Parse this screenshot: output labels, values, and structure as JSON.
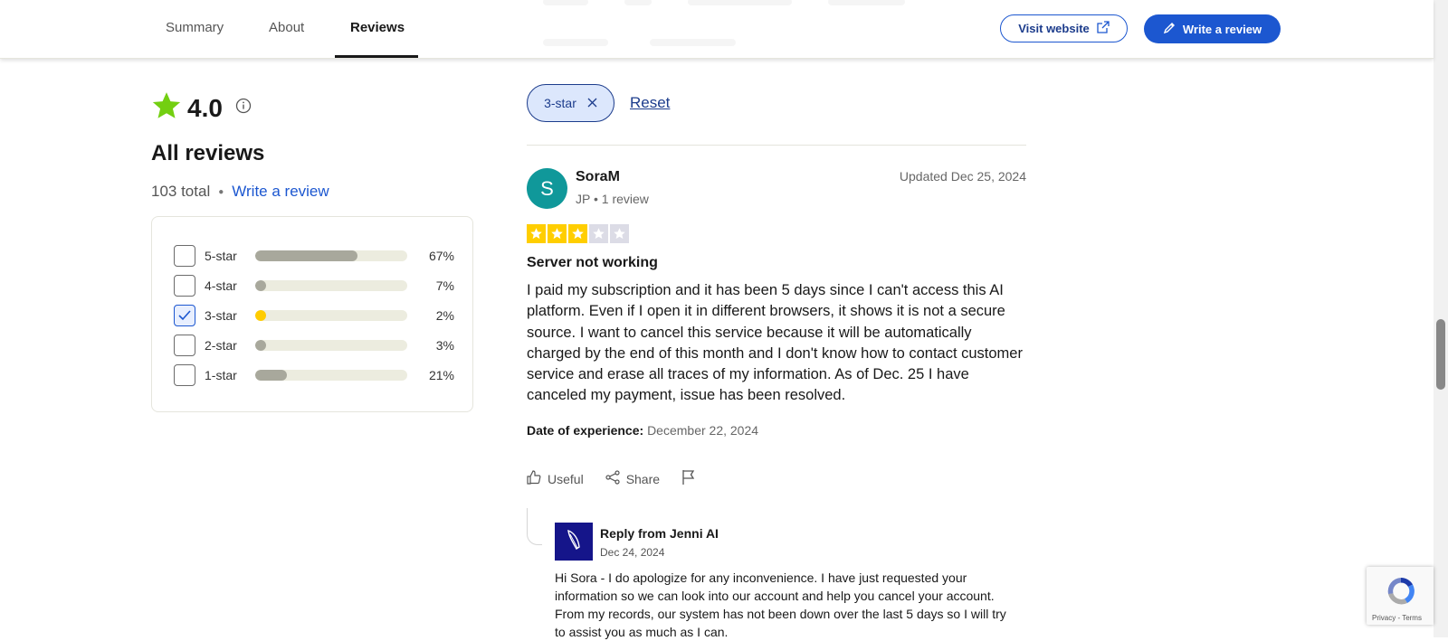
{
  "nav": {
    "tabs": [
      {
        "label": "Summary"
      },
      {
        "label": "About"
      },
      {
        "label": "Reviews"
      }
    ],
    "visit_website": "Visit website",
    "write_review": "Write a review"
  },
  "summary": {
    "rating": "4.0",
    "heading": "All reviews",
    "total": "103 total",
    "write_review_link": "Write a review"
  },
  "distribution": [
    {
      "label": "5-star",
      "percent": "67%",
      "fraction": 0.67,
      "checked": false
    },
    {
      "label": "4-star",
      "percent": "7%",
      "fraction": 0.07,
      "checked": false
    },
    {
      "label": "3-star",
      "percent": "2%",
      "fraction": 0.02,
      "checked": true
    },
    {
      "label": "2-star",
      "percent": "3%",
      "fraction": 0.03,
      "checked": false
    },
    {
      "label": "1-star",
      "percent": "21%",
      "fraction": 0.21,
      "checked": false
    }
  ],
  "filter": {
    "chip_label": "3-star",
    "reset": "Reset"
  },
  "review": {
    "avatar_initial": "S",
    "name": "SoraM",
    "meta": "JP • 1 review",
    "date": "Updated Dec 25, 2024",
    "stars": 3,
    "stars_max": 5,
    "title": "Server not working",
    "body": "I paid my subscription and it has been 5 days since I can't access this AI platform. Even if I open it in different browsers, it shows it is not a secure source. I want to cancel this service because it will be automatically charged by the end of this month and I don't know how to contact customer service and erase all traces of my information. As of Dec. 25 I have canceled my payment, issue has been resolved.",
    "experience_label": "Date of experience:",
    "experience_date": "December 22, 2024",
    "useful": "Useful",
    "share": "Share"
  },
  "reply": {
    "from": "Reply from Jenni AI",
    "date": "Dec 24, 2024",
    "body": "Hi Sora - I do apologize for any inconvenience. I have just requested your information so we can look into our account and help you cancel your account. From my records, our system has not been down over the last 5 days so I will try to assist you as much as I can."
  },
  "recaptcha": {
    "links": "Privacy - Terms"
  },
  "colors": {
    "brand_blue": "#1c57d0",
    "star_green": "#73cf11",
    "star_yellow": "#ffce00",
    "avatar_teal": "#10989a",
    "reply_logo": "#15158a"
  }
}
